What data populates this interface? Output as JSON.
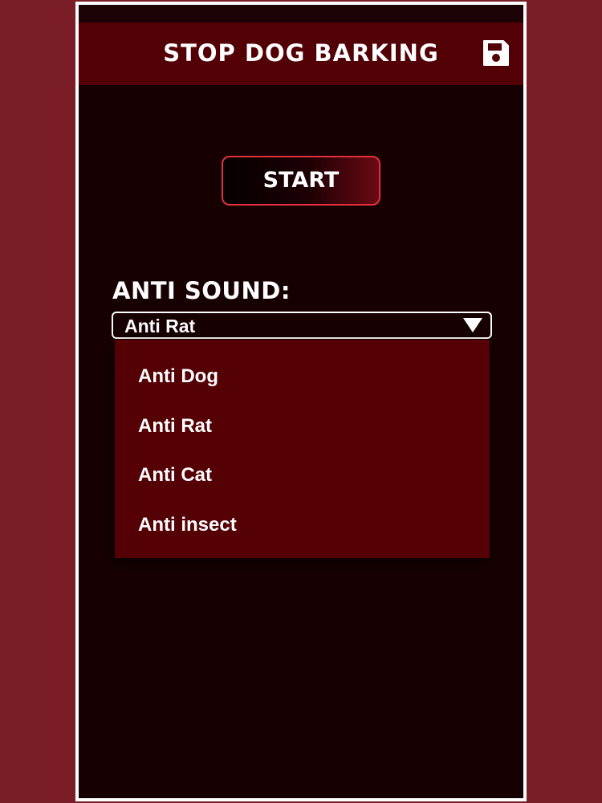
{
  "header": {
    "title": "STOP DOG BARKING",
    "save_icon": "floppy-disk-icon"
  },
  "start_button": {
    "label": "START"
  },
  "anti_sound": {
    "label": "ANTI SOUND:",
    "selected": "Anti Rat",
    "options": [
      "Anti Dog",
      "Anti Rat",
      "Anti Cat",
      "Anti insect"
    ]
  },
  "colors": {
    "background": "#7a1d27",
    "screen": "#170002",
    "appbar": "#520005",
    "dropdown": "#540005",
    "button_border": "#e2313d"
  }
}
